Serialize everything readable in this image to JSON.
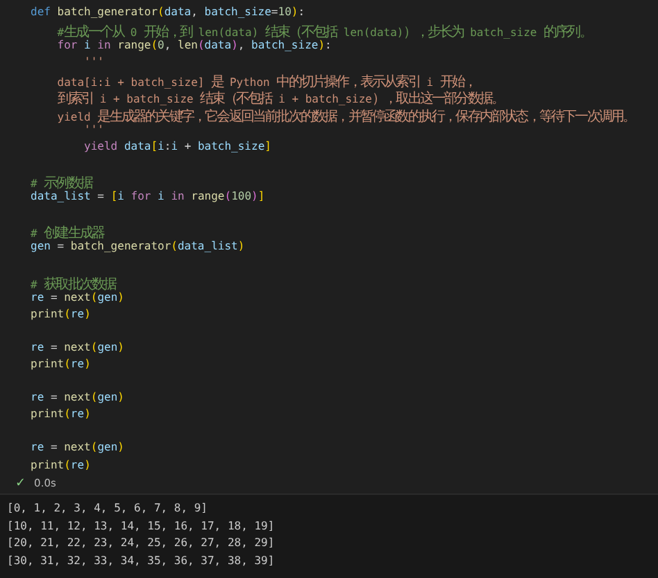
{
  "code_cell": {
    "lines": [
      {
        "kind": "code",
        "tokens": [
          {
            "kind": "kw",
            "text": "def "
          },
          {
            "kind": "fn",
            "text": "batch_generator"
          },
          {
            "kind": "b1",
            "text": "("
          },
          {
            "kind": "var",
            "text": "data"
          },
          {
            "kind": "p",
            "text": ", "
          },
          {
            "kind": "var",
            "text": "batch_size"
          },
          {
            "kind": "p",
            "text": "="
          },
          {
            "kind": "num",
            "text": "10"
          },
          {
            "kind": "b1",
            "text": ")"
          },
          {
            "kind": "p",
            "text": ":"
          }
        ]
      },
      {
        "kind": "code",
        "tokens": [
          {
            "kind": "cm",
            "text": "    #生成一个从 0 开始，到 len(data) 结束（不包括 len(data)），步长为 batch_size 的序列。"
          }
        ]
      },
      {
        "kind": "code",
        "tokens": [
          {
            "kind": "ctl",
            "text": "    for "
          },
          {
            "kind": "var",
            "text": "i "
          },
          {
            "kind": "ctl",
            "text": "in "
          },
          {
            "kind": "fn",
            "text": "range"
          },
          {
            "kind": "b1",
            "text": "("
          },
          {
            "kind": "num",
            "text": "0"
          },
          {
            "kind": "p",
            "text": ", "
          },
          {
            "kind": "fn",
            "text": "len"
          },
          {
            "kind": "b2",
            "text": "("
          },
          {
            "kind": "var",
            "text": "data"
          },
          {
            "kind": "b2",
            "text": ")"
          },
          {
            "kind": "p",
            "text": ", "
          },
          {
            "kind": "var",
            "text": "batch_size"
          },
          {
            "kind": "b1",
            "text": ")"
          },
          {
            "kind": "p",
            "text": ":"
          }
        ]
      },
      {
        "kind": "code",
        "tokens": [
          {
            "kind": "str",
            "text": "        '''"
          }
        ]
      },
      {
        "kind": "code",
        "tokens": [
          {
            "kind": "str",
            "text": "    data[i:i + batch_size] 是 Python 中的切片操作，表示从索引 i 开始，"
          }
        ]
      },
      {
        "kind": "code",
        "tokens": [
          {
            "kind": "str",
            "text": "    到索引 i + batch_size 结束（不包括 i + batch_size），取出这一部分数据。"
          }
        ]
      },
      {
        "kind": "code",
        "tokens": [
          {
            "kind": "str",
            "text": "    yield 是生成器的关键字，它会返回当前批次的数据，并暂停函数的执行，保存内部状态，等待下一次调用。"
          }
        ]
      },
      {
        "kind": "code",
        "tokens": [
          {
            "kind": "str",
            "text": "        '''"
          }
        ]
      },
      {
        "kind": "code",
        "tokens": [
          {
            "kind": "ctl",
            "text": "        yield "
          },
          {
            "kind": "var",
            "text": "data"
          },
          {
            "kind": "b1",
            "text": "["
          },
          {
            "kind": "var",
            "text": "i"
          },
          {
            "kind": "p",
            "text": ":"
          },
          {
            "kind": "var",
            "text": "i "
          },
          {
            "kind": "p",
            "text": "+ "
          },
          {
            "kind": "var",
            "text": "batch_size"
          },
          {
            "kind": "b1",
            "text": "]"
          }
        ]
      },
      {
        "kind": "blank"
      },
      {
        "kind": "code",
        "tokens": [
          {
            "kind": "cm",
            "text": "# 示例数据"
          }
        ]
      },
      {
        "kind": "code",
        "tokens": [
          {
            "kind": "var",
            "text": "data_list "
          },
          {
            "kind": "p",
            "text": "= "
          },
          {
            "kind": "b1",
            "text": "["
          },
          {
            "kind": "var",
            "text": "i "
          },
          {
            "kind": "ctl",
            "text": "for "
          },
          {
            "kind": "var",
            "text": "i "
          },
          {
            "kind": "ctl",
            "text": "in "
          },
          {
            "kind": "fn",
            "text": "range"
          },
          {
            "kind": "b2",
            "text": "("
          },
          {
            "kind": "num",
            "text": "100"
          },
          {
            "kind": "b2",
            "text": ")"
          },
          {
            "kind": "b1",
            "text": "]"
          }
        ]
      },
      {
        "kind": "blank"
      },
      {
        "kind": "code",
        "tokens": [
          {
            "kind": "cm",
            "text": "# 创建生成器"
          }
        ]
      },
      {
        "kind": "code",
        "tokens": [
          {
            "kind": "var",
            "text": "gen "
          },
          {
            "kind": "p",
            "text": "= "
          },
          {
            "kind": "fn",
            "text": "batch_generator"
          },
          {
            "kind": "b1",
            "text": "("
          },
          {
            "kind": "var",
            "text": "data_list"
          },
          {
            "kind": "b1",
            "text": ")"
          }
        ]
      },
      {
        "kind": "blank"
      },
      {
        "kind": "code",
        "tokens": [
          {
            "kind": "cm",
            "text": "# 获取批次数据"
          }
        ]
      },
      {
        "kind": "code",
        "tokens": [
          {
            "kind": "var",
            "text": "re "
          },
          {
            "kind": "p",
            "text": "= "
          },
          {
            "kind": "fn",
            "text": "next"
          },
          {
            "kind": "b1",
            "text": "("
          },
          {
            "kind": "var",
            "text": "gen"
          },
          {
            "kind": "b1",
            "text": ")"
          }
        ]
      },
      {
        "kind": "code",
        "tokens": [
          {
            "kind": "fn",
            "text": "print"
          },
          {
            "kind": "b1",
            "text": "("
          },
          {
            "kind": "var",
            "text": "re"
          },
          {
            "kind": "b1",
            "text": ")"
          }
        ]
      },
      {
        "kind": "blank"
      },
      {
        "kind": "code",
        "tokens": [
          {
            "kind": "var",
            "text": "re "
          },
          {
            "kind": "p",
            "text": "= "
          },
          {
            "kind": "fn",
            "text": "next"
          },
          {
            "kind": "b1",
            "text": "("
          },
          {
            "kind": "var",
            "text": "gen"
          },
          {
            "kind": "b1",
            "text": ")"
          }
        ]
      },
      {
        "kind": "code",
        "tokens": [
          {
            "kind": "fn",
            "text": "print"
          },
          {
            "kind": "b1",
            "text": "("
          },
          {
            "kind": "var",
            "text": "re"
          },
          {
            "kind": "b1",
            "text": ")"
          }
        ]
      },
      {
        "kind": "blank"
      },
      {
        "kind": "code",
        "tokens": [
          {
            "kind": "var",
            "text": "re "
          },
          {
            "kind": "p",
            "text": "= "
          },
          {
            "kind": "fn",
            "text": "next"
          },
          {
            "kind": "b1",
            "text": "("
          },
          {
            "kind": "var",
            "text": "gen"
          },
          {
            "kind": "b1",
            "text": ")"
          }
        ]
      },
      {
        "kind": "code",
        "tokens": [
          {
            "kind": "fn",
            "text": "print"
          },
          {
            "kind": "b1",
            "text": "("
          },
          {
            "kind": "var",
            "text": "re"
          },
          {
            "kind": "b1",
            "text": ")"
          }
        ]
      },
      {
        "kind": "blank"
      },
      {
        "kind": "code",
        "tokens": [
          {
            "kind": "var",
            "text": "re "
          },
          {
            "kind": "p",
            "text": "= "
          },
          {
            "kind": "fn",
            "text": "next"
          },
          {
            "kind": "b1",
            "text": "("
          },
          {
            "kind": "var",
            "text": "gen"
          },
          {
            "kind": "b1",
            "text": ")"
          }
        ]
      },
      {
        "kind": "code",
        "tokens": [
          {
            "kind": "fn",
            "text": "print"
          },
          {
            "kind": "b1",
            "text": "("
          },
          {
            "kind": "var",
            "text": "re"
          },
          {
            "kind": "b1",
            "text": ")"
          }
        ]
      }
    ]
  },
  "status": {
    "success": true,
    "icon": "✓",
    "duration": "0.0s"
  },
  "output": {
    "lines": [
      "[0, 1, 2, 3, 4, 5, 6, 7, 8, 9]",
      "[10, 11, 12, 13, 14, 15, 16, 17, 18, 19]",
      "[20, 21, 22, 23, 24, 25, 26, 27, 28, 29]",
      "[30, 31, 32, 33, 34, 35, 36, 37, 38, 39]"
    ]
  }
}
